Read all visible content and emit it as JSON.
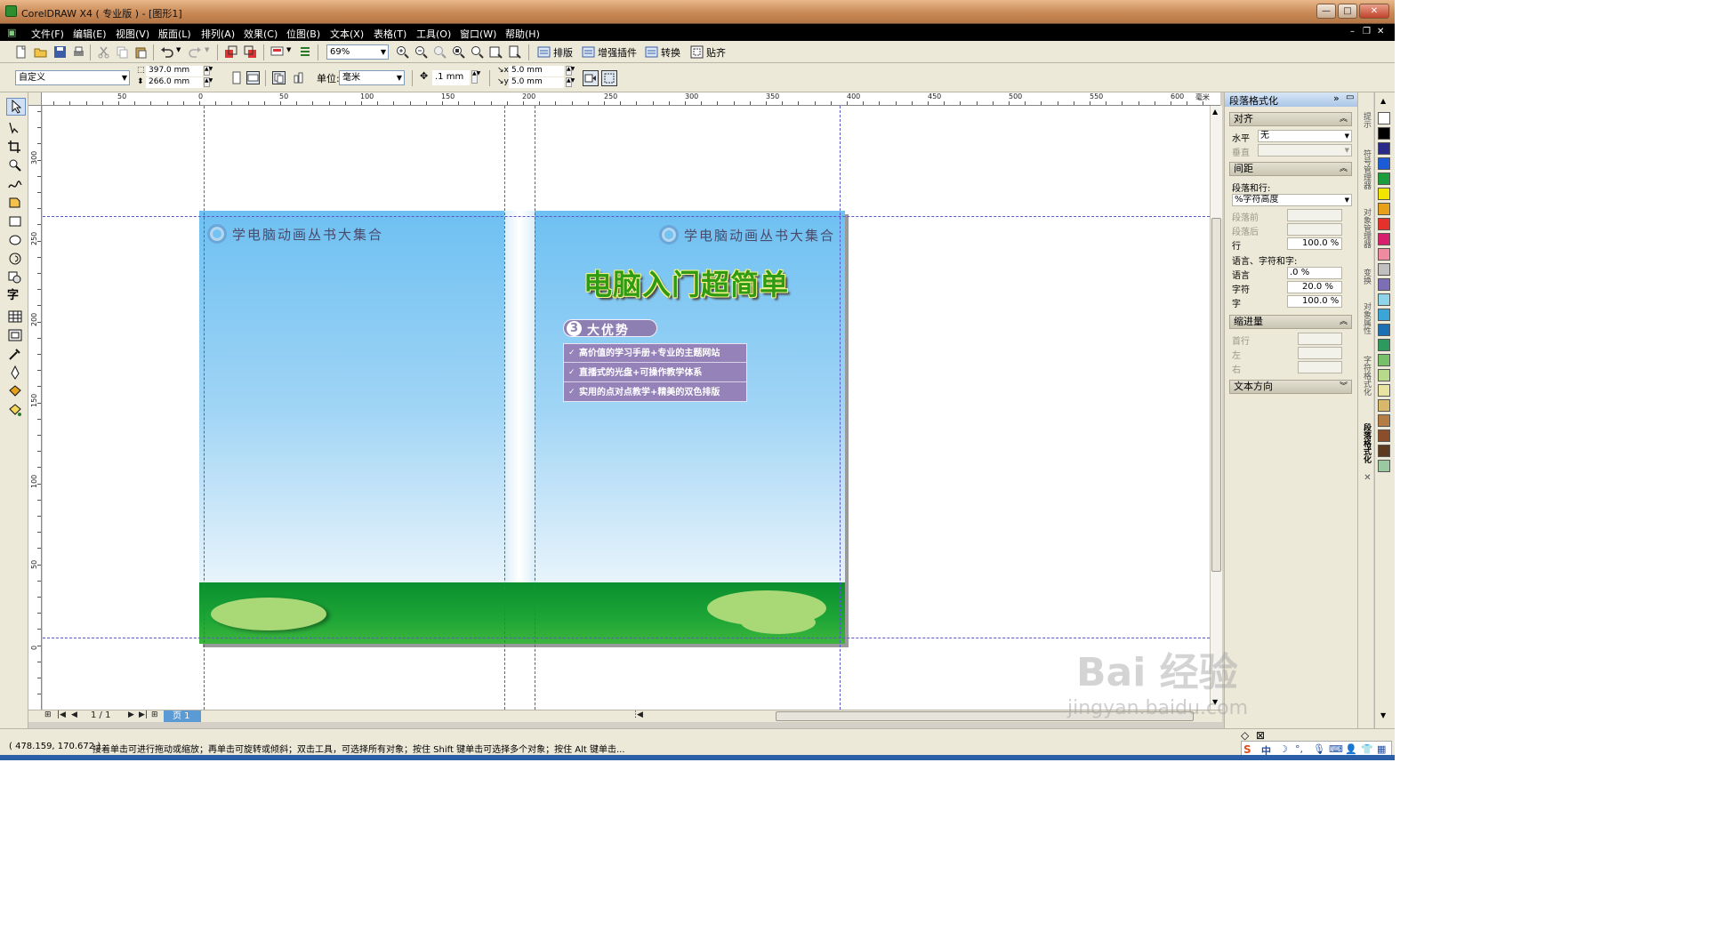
{
  "window": {
    "title": "CorelDRAW X4 ( 专业版 ) - [图形1]"
  },
  "menu": [
    "文件(F)",
    "编辑(E)",
    "视图(V)",
    "版面(L)",
    "排列(A)",
    "效果(C)",
    "位图(B)",
    "文本(X)",
    "表格(T)",
    "工具(O)",
    "窗口(W)",
    "帮助(H)"
  ],
  "toolbar": {
    "zoom": "69%",
    "typeset": "排版",
    "plugins": "增强插件",
    "convert": "转换",
    "snap": "贴齐"
  },
  "propbar": {
    "page_preset": "自定义",
    "width": "397.0 mm",
    "height": "266.0 mm",
    "units_label": "单位:",
    "units": "毫米",
    "nudge": ".1 mm",
    "dup_x": "5.0 mm",
    "dup_y": "5.0 mm"
  },
  "ruler": {
    "h_labels": [
      "50",
      "0",
      "50",
      "100",
      "150",
      "200",
      "250",
      "300",
      "350",
      "400",
      "450",
      "500",
      "550",
      "600"
    ],
    "h_unit": "毫米",
    "v_labels": [
      "300",
      "250",
      "200",
      "150",
      "100",
      "50",
      "0"
    ]
  },
  "cover": {
    "series": "学电脑动画丛书大集合",
    "title": "电脑入门超简单",
    "adv_num": "3",
    "adv_label": "大优势",
    "advantages": [
      "高价值的学习手册+专业的主题网站",
      "直播式的光盘+可操作教学体系",
      "实用的点对点教学+精美的双色排版"
    ]
  },
  "pagebar": {
    "page_count": "1 / 1",
    "page_tab": "页 1"
  },
  "docker": {
    "title": "段落格式化",
    "align_section": "对齐",
    "horizontal_label": "水平",
    "horizontal_value": "无",
    "vertical_label": "垂直",
    "spacing_section": "间距",
    "para_line_label": "段落和行:",
    "para_line_value": "%字符高度",
    "before_para": "段落前",
    "after_para": "段落后",
    "line_label": "行",
    "line_value": "100.0 %",
    "lang_char_word": "语言、字符和字:",
    "lang_label": "语言",
    "lang_value": ".0 %",
    "char_label": "字符",
    "char_value": "20.0 %",
    "word_label": "字",
    "word_value": "100.0 %",
    "indent_section": "缩进量",
    "first_line": "首行",
    "left": "左",
    "right": "右",
    "text_dir_section": "文本方向"
  },
  "side_tabs": [
    "提示",
    "符号管理器",
    "对象管理器",
    "变换",
    "对象属性",
    "字符格式化",
    "段落格式化"
  ],
  "palette_colors": [
    "#ffffff",
    "#000000",
    "#2a2a8a",
    "#1c5bd6",
    "#1a9d3a",
    "#f2e500",
    "#e8a018",
    "#e5312a",
    "#d71f6d",
    "#f08aa0",
    "#c0c0c0",
    "#7d6fb5",
    "#8fd3e8",
    "#3ba5d8",
    "#1b6fb3",
    "#2c9a5c",
    "#77c068",
    "#b6d98a",
    "#e9e3a0",
    "#d8b86a",
    "#b57d43",
    "#8a4f2a",
    "#5d3a1f",
    "#9ac9a1"
  ],
  "status": {
    "coords": "( 478.159, 170.672 )",
    "message": "接着单击可进行拖动或缩放；再单击可旋转或倾斜；双击工具，可选择所有对象；按住 Shift 键单击可选择多个对象；按住 Alt 键单击..."
  },
  "watermark": {
    "brand": "Bai 经验",
    "url": "jingyan.baidu.com"
  }
}
